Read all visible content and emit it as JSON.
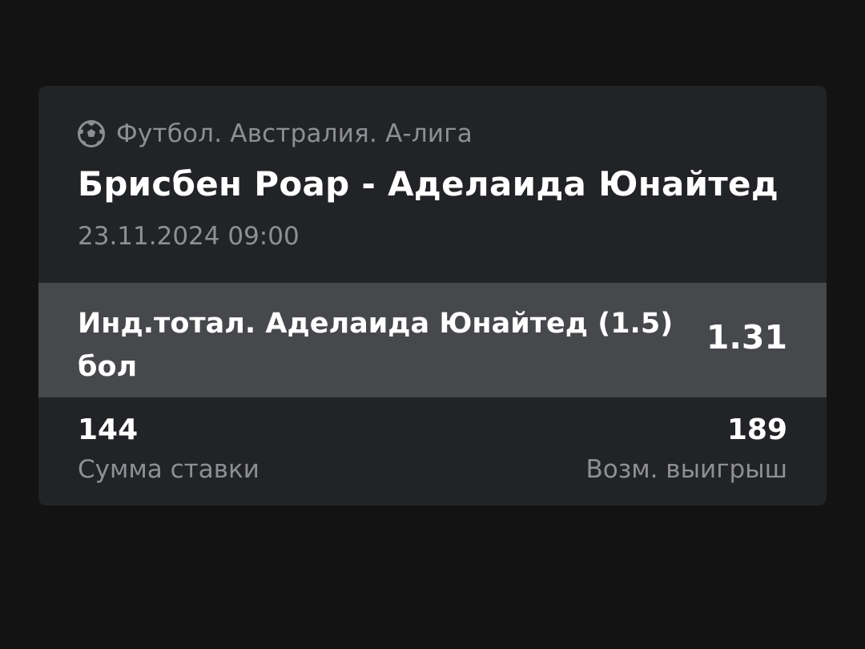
{
  "bet_card": {
    "league_icon": "soccer-ball-icon",
    "league": "Футбол. Австралия. А-лига",
    "match": "Брисбен Роар - Аделаида Юнайтед",
    "datetime": "23.11.2024 09:00",
    "bet_name": "Инд.тотал. Аделаида Юнайтед (1.5) бол",
    "odds": "1.31",
    "stake_value": "144",
    "stake_label": "Сумма ставки",
    "win_value": "189",
    "win_label": "Возм. выигрыш"
  },
  "colors": {
    "background": "#131313",
    "card": "#222326",
    "bet_row": "#47484c",
    "primary_text": "#ffffff",
    "secondary_text": "#8e8f94"
  }
}
